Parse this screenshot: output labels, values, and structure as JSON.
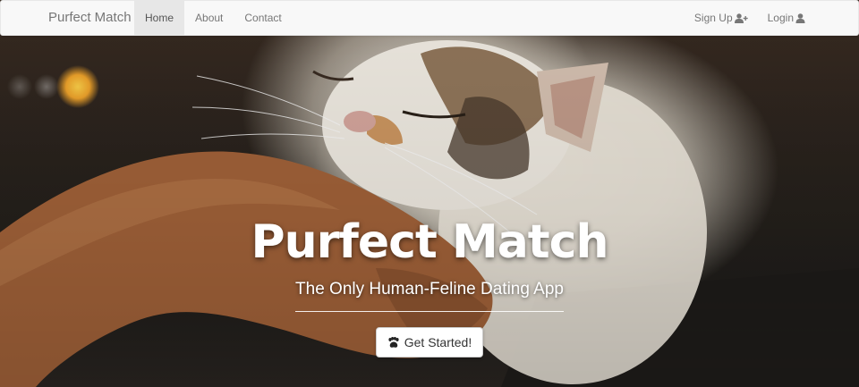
{
  "navbar": {
    "brand": "Purfect Match",
    "left_items": [
      {
        "label": "Home",
        "active": true
      },
      {
        "label": "About",
        "active": false
      },
      {
        "label": "Contact",
        "active": false
      }
    ],
    "right_items": [
      {
        "label": "Sign Up",
        "icon": "user-plus-icon"
      },
      {
        "label": "Login",
        "icon": "user-icon"
      }
    ]
  },
  "hero": {
    "title": "Purfect Match",
    "subtitle": "The Only Human-Feline Dating App",
    "cta_label": "Get Started!",
    "cta_icon": "paw-icon",
    "background": "photo of a hand scratching a calico cat's chin"
  },
  "colors": {
    "navbar_bg": "#f8f8f8",
    "nav_text": "#777777",
    "active_tab_bg": "#e7e7e7",
    "hero_text": "#ffffff"
  }
}
